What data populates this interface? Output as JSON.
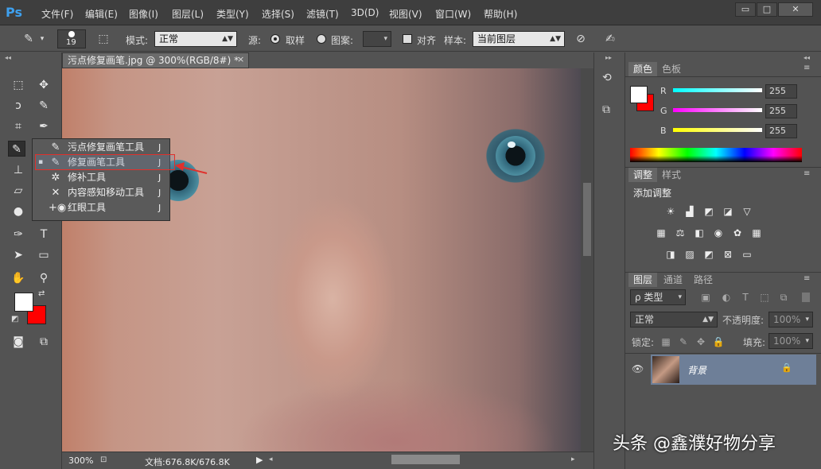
{
  "app": {
    "logo": "Ps"
  },
  "menu": [
    "文件(F)",
    "编辑(E)",
    "图像(I)",
    "图层(L)",
    "类型(Y)",
    "选择(S)",
    "滤镜(T)",
    "3D(D)",
    "视图(V)",
    "窗口(W)",
    "帮助(H)"
  ],
  "window_controls": {
    "minimize": "▭",
    "restore": "□",
    "close": "✕"
  },
  "options": {
    "brush_size": "19",
    "mode_label": "模式:",
    "mode_value": "正常",
    "source_label": "源:",
    "sampled_label": "取样",
    "pattern_label": "图案:",
    "align_label": "对齐",
    "sample_label": "样本:",
    "sample_value": "当前图层"
  },
  "document": {
    "tab_title": "污点修复画笔.jpg @ 300%(RGB/8#) *",
    "close": "×",
    "zoom": "300%",
    "doc_info": "文档:676.8K/676.8K"
  },
  "flyout": [
    {
      "label": "污点修复画笔工具",
      "key": "J",
      "icon": "spot-healing-icon"
    },
    {
      "label": "修复画笔工具",
      "key": "J",
      "icon": "healing-brush-icon",
      "selected": true
    },
    {
      "label": "修补工具",
      "key": "J",
      "icon": "patch-icon"
    },
    {
      "label": "内容感知移动工具",
      "key": "J",
      "icon": "content-aware-move-icon"
    },
    {
      "label": "红眼工具",
      "key": "J",
      "icon": "red-eye-icon"
    }
  ],
  "color_panel": {
    "tabs": [
      "颜色",
      "色板"
    ],
    "r_label": "R",
    "g_label": "G",
    "b_label": "B",
    "r": "255",
    "g": "255",
    "b": "255",
    "foreground": "#ffffff",
    "background": "#ff0000"
  },
  "adjustments_panel": {
    "tabs": [
      "调整",
      "样式"
    ],
    "title": "添加调整"
  },
  "layers_panel": {
    "tabs": [
      "图层",
      "通道",
      "路径"
    ],
    "filter_label": "ρ 类型",
    "blend_mode": "正常",
    "opacity_label": "不透明度:",
    "opacity_value": "100%",
    "lock_label": "锁定:",
    "fill_label": "填充:",
    "fill_value": "100%",
    "layer_name": "背景"
  },
  "watermark": "头条 @鑫濮好物分享"
}
